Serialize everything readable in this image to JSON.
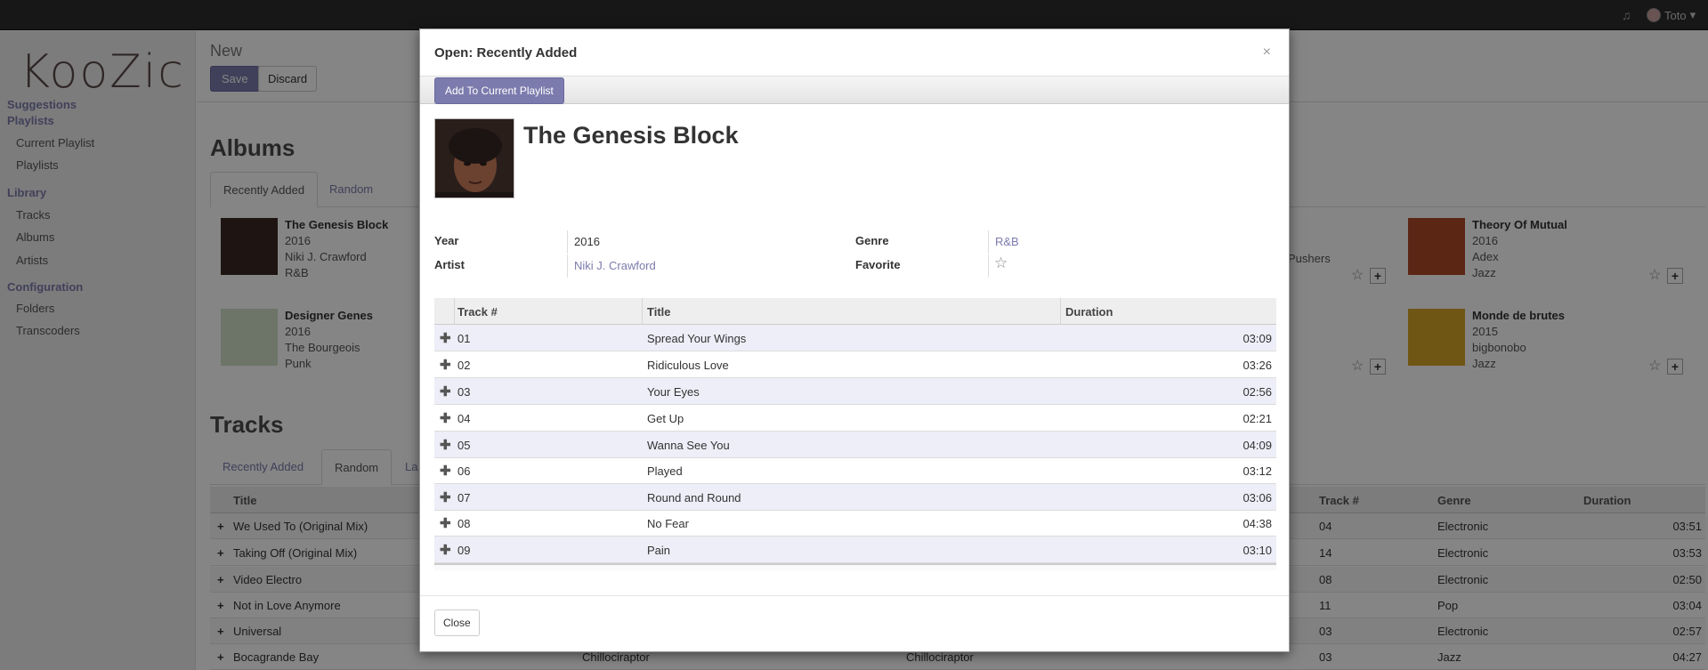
{
  "topbar": {
    "music_icon": "music-icon",
    "user_name": "Toto",
    "user_caret": "▾"
  },
  "sidebar": {
    "logo": "KooZic",
    "sections": [
      {
        "label": "Suggestions"
      },
      {
        "label": "Playlists",
        "items": [
          "Current Playlist",
          "Playlists"
        ]
      },
      {
        "label": "Library",
        "items": [
          "Tracks",
          "Albums",
          "Artists"
        ]
      },
      {
        "label": "Configuration",
        "items": [
          "Folders",
          "Transcoders"
        ]
      }
    ]
  },
  "control_panel": {
    "breadcrumb": "New",
    "save_label": "Save",
    "discard_label": "Discard"
  },
  "albums": {
    "heading": "Albums",
    "tabs": [
      "Recently Added",
      "Random"
    ],
    "cards": [
      {
        "title": "The Genesis Block",
        "year": "2016",
        "artist": "Niki J. Crawford",
        "genre": "R&B"
      },
      {
        "title": "Designer Genes",
        "year": "2016",
        "artist": "The Bourgeois",
        "genre": "Punk"
      },
      {
        "title": "Theory Of Mutual",
        "year": "2016",
        "artist": "Adex",
        "genre": "Jazz"
      },
      {
        "title": "Monde de brutes",
        "year": "2015",
        "artist": "bigbonobo",
        "genre": "Jazz"
      }
    ],
    "partial_text": "Pushers"
  },
  "tracks": {
    "heading": "Tracks",
    "tabs": [
      "Recently Added",
      "Random",
      "La"
    ],
    "columns": {
      "title": "Title",
      "track": "Track #",
      "genre": "Genre",
      "duration": "Duration"
    },
    "rows": [
      {
        "title": "We Used To (Original Mix)",
        "c2": "",
        "c3": "",
        "track": "04",
        "genre": "Electronic",
        "duration": "03:51"
      },
      {
        "title": "Taking Off (Original Mix)",
        "c2": "",
        "c3": "",
        "track": "14",
        "genre": "Electronic",
        "duration": "03:53"
      },
      {
        "title": "Video Electro",
        "c2": "",
        "c3": "",
        "track": "08",
        "genre": "Electronic",
        "duration": "02:50"
      },
      {
        "title": "Not in Love Anymore",
        "c2": "",
        "c3": "",
        "track": "11",
        "genre": "Pop",
        "duration": "03:04"
      },
      {
        "title": "Universal",
        "c2": "",
        "c3": "",
        "track": "03",
        "genre": "Electronic",
        "duration": "02:57"
      },
      {
        "title": "Bocagrande Bay",
        "c2": "Chillociraptor",
        "c3": "Chillociraptor",
        "track": "03",
        "genre": "Jazz",
        "duration": "04:27"
      }
    ]
  },
  "modal": {
    "title": "Open: Recently Added",
    "close_x": "×",
    "add_button": "Add To Current Playlist",
    "album_title": "The Genesis Block",
    "fields": {
      "year_label": "Year",
      "year_value": "2016",
      "artist_label": "Artist",
      "artist_value": "Niki J. Crawford",
      "genre_label": "Genre",
      "genre_value": "R&B",
      "favorite_label": "Favorite"
    },
    "table": {
      "columns": {
        "track": "Track #",
        "title": "Title",
        "duration": "Duration"
      },
      "rows": [
        {
          "track": "01",
          "title": "Spread Your Wings",
          "duration": "03:09"
        },
        {
          "track": "02",
          "title": "Ridiculous Love",
          "duration": "03:26"
        },
        {
          "track": "03",
          "title": "Your Eyes",
          "duration": "02:56"
        },
        {
          "track": "04",
          "title": "Get Up",
          "duration": "02:21"
        },
        {
          "track": "05",
          "title": "Wanna See You",
          "duration": "04:09"
        },
        {
          "track": "06",
          "title": "Played",
          "duration": "03:12"
        },
        {
          "track": "07",
          "title": "Round and Round",
          "duration": "03:06"
        },
        {
          "track": "08",
          "title": "No Fear",
          "duration": "04:38"
        },
        {
          "track": "09",
          "title": "Pain",
          "duration": "03:10"
        }
      ]
    },
    "close_button": "Close"
  },
  "colors": {
    "accent": "#7c7bad",
    "topbar": "#2c2c2c",
    "sidebar": "#f0eeee"
  }
}
